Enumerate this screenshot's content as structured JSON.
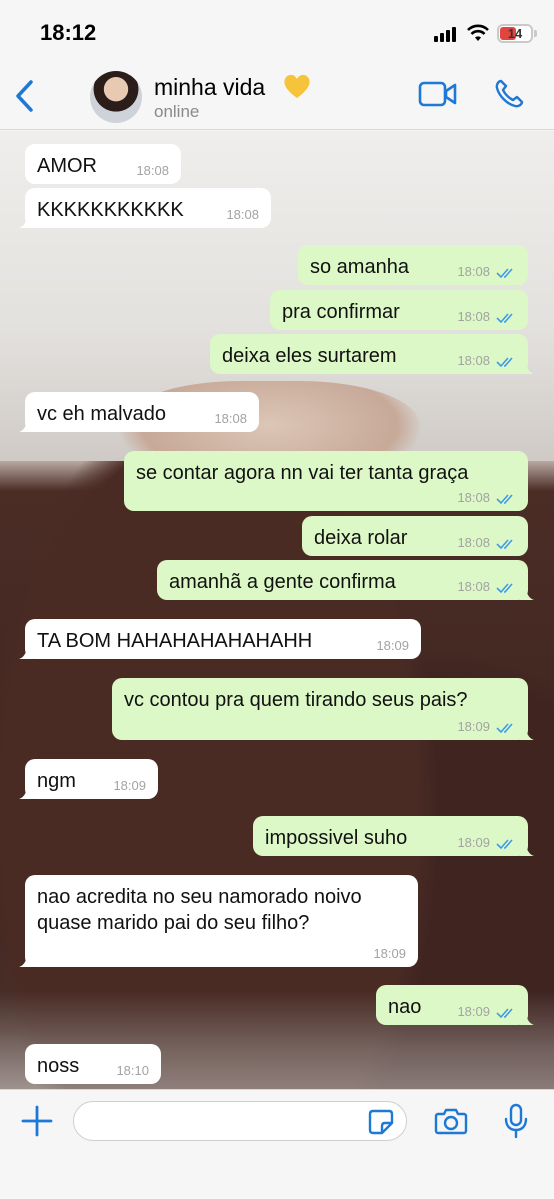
{
  "status_bar": {
    "time": "18:12",
    "battery": "14"
  },
  "header": {
    "name": "minha vida",
    "status": "online"
  },
  "messages": [
    {
      "text": "AMOR",
      "time": "18:08"
    },
    {
      "text": "KKKKKKKKKKK",
      "time": "18:08"
    },
    {
      "text": "so amanha",
      "time": "18:08"
    },
    {
      "text": "pra confirmar",
      "time": "18:08"
    },
    {
      "text": "deixa eles surtarem",
      "time": "18:08"
    },
    {
      "text": "vc eh malvado",
      "time": "18:08"
    },
    {
      "text": "se contar agora nn vai ter tanta graça",
      "time": "18:08"
    },
    {
      "text": "deixa rolar",
      "time": "18:08"
    },
    {
      "text": "amanhã a gente confirma",
      "time": "18:08"
    },
    {
      "text": "TA BOM HAHAHAHAHAHAHH",
      "time": "18:09"
    },
    {
      "text": "vc contou pra quem tirando seus pais?",
      "time": "18:09"
    },
    {
      "text": "ngm",
      "time": "18:09"
    },
    {
      "text": "impossivel suho",
      "time": "18:09"
    },
    {
      "text": "nao acredita no seu namorado noivo quase marido pai do seu filho?",
      "time": "18:09"
    },
    {
      "text": "nao",
      "time": "18:09"
    },
    {
      "text": "noss",
      "time": "18:10"
    }
  ],
  "colors": {
    "accent": "#1e78d6",
    "outgoing": "#dcf8c6",
    "incoming": "#ffffff",
    "read_ticks": "#3f9be8"
  },
  "icons": [
    "back-chevron-icon",
    "heart-icon",
    "video-icon",
    "phone-icon",
    "plus-icon",
    "sticker-icon",
    "camera-icon",
    "mic-icon"
  ]
}
